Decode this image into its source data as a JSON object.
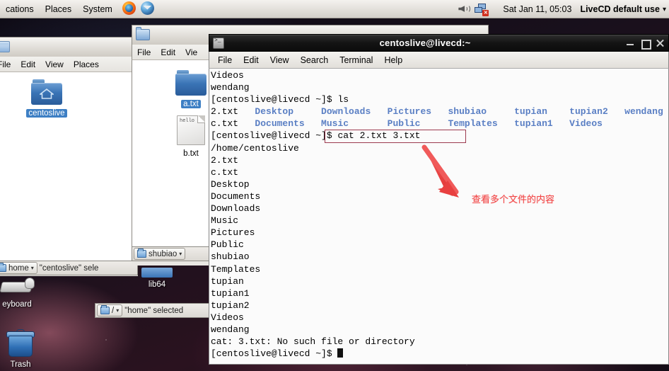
{
  "panel": {
    "menus": [
      "cations",
      "Places",
      "System"
    ],
    "launchers": [
      "firefox-icon",
      "thunderbird-icon"
    ],
    "tray": [
      "volume-icon",
      "network-disconnected-icon"
    ],
    "clock": "Sat Jan 11, 05:03",
    "user": "LiveCD default use",
    "user_arrow": "▾"
  },
  "desktop": {
    "icons": [
      {
        "label": "eyboard",
        "icon": "keyboard-mouse-icon"
      },
      {
        "label": "Trash",
        "icon": "trash-icon"
      }
    ]
  },
  "file_manager_back": {
    "menus": [
      "File",
      "Edit",
      "View",
      "Places"
    ],
    "item": {
      "label": "centoslive",
      "icon": "home-folder-icon"
    },
    "location": "home",
    "status": "\"centoslive\" sele"
  },
  "file_manager_mid": {
    "menus": [
      "File",
      "Edit",
      "Vie"
    ],
    "items": [
      {
        "label": "a.txt",
        "icon": "folder-icon",
        "selected": true
      },
      {
        "label": "b.txt",
        "icon": "text-document-icon",
        "preview": "hello",
        "selected": false
      }
    ],
    "location": "shubiao",
    "folder_below": "lib64",
    "location2": "/",
    "status2": "\"home\" selected"
  },
  "terminal": {
    "title": "centoslive@livecd:~",
    "menus": [
      "File",
      "Edit",
      "View",
      "Search",
      "Terminal",
      "Help"
    ],
    "window_buttons": [
      "minimize-button",
      "maximize-button",
      "close-button"
    ],
    "prompt": "[centoslive@livecd ~]$",
    "lines": [
      {
        "type": "plain",
        "text": "Videos"
      },
      {
        "type": "plain",
        "text": "wendang"
      },
      {
        "type": "cmd",
        "prompt": "[centoslive@livecd ~]$",
        "cmd": " ls"
      },
      {
        "type": "ls",
        "cols": [
          {
            "t": "2.txt",
            "d": false
          },
          {
            "t": "Desktop",
            "d": true
          },
          {
            "t": "Downloads",
            "d": true
          },
          {
            "t": "Pictures",
            "d": true
          },
          {
            "t": "shubiao",
            "d": true
          },
          {
            "t": "tupian",
            "d": true
          },
          {
            "t": "tupian2",
            "d": true
          },
          {
            "t": "wendang",
            "d": true
          }
        ]
      },
      {
        "type": "ls",
        "cols": [
          {
            "t": "c.txt",
            "d": false
          },
          {
            "t": "Documents",
            "d": true
          },
          {
            "t": "Music",
            "d": true
          },
          {
            "t": "Public",
            "d": true
          },
          {
            "t": "Templates",
            "d": true
          },
          {
            "t": "tupian1",
            "d": true
          },
          {
            "t": "Videos",
            "d": true
          }
        ]
      },
      {
        "type": "cmd",
        "prompt": "[centoslive@livecd ~]$",
        "cmd": " cat 2.txt 3.txt",
        "boxed": true
      },
      {
        "type": "plain",
        "text": "/home/centoslive"
      },
      {
        "type": "plain",
        "text": "2.txt"
      },
      {
        "type": "plain",
        "text": "c.txt"
      },
      {
        "type": "plain",
        "text": "Desktop"
      },
      {
        "type": "plain",
        "text": "Documents"
      },
      {
        "type": "plain",
        "text": "Downloads"
      },
      {
        "type": "plain",
        "text": "Music"
      },
      {
        "type": "plain",
        "text": "Pictures"
      },
      {
        "type": "plain",
        "text": "Public"
      },
      {
        "type": "plain",
        "text": "shubiao"
      },
      {
        "type": "plain",
        "text": "Templates"
      },
      {
        "type": "plain",
        "text": "tupian"
      },
      {
        "type": "plain",
        "text": "tupian1"
      },
      {
        "type": "plain",
        "text": "tupian2"
      },
      {
        "type": "plain",
        "text": "Videos"
      },
      {
        "type": "plain",
        "text": "wendang"
      },
      {
        "type": "plain",
        "text": "cat: 3.txt: No such file or directory"
      },
      {
        "type": "final_prompt",
        "prompt": "[centoslive@livecd ~]$"
      }
    ]
  },
  "annotation": {
    "text": "查看多个文件的内容",
    "color": "#f24a4a",
    "box_color": "#9c3b50",
    "arrow": "red-arrow-pointing-down-left"
  }
}
